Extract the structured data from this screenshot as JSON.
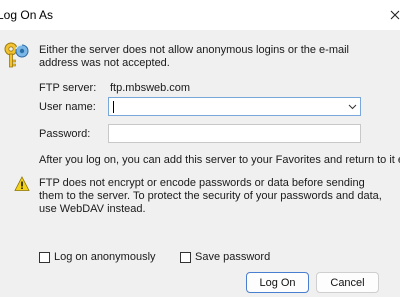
{
  "window": {
    "title": "Log On As"
  },
  "messages": {
    "anonymous_warning": "Either the server does not allow anonymous logins or the e-mail address was not accepted.",
    "favorites_note": "After you log on, you can add this server to your Favorites and return to it easily.",
    "security_warning": "FTP does not encrypt or encode passwords or data before sending them to the server.  To protect the security of your passwords and data, use WebDAV instead."
  },
  "ftp_server": {
    "label": "FTP server:",
    "value": "ftp.mbsweb.com"
  },
  "user_name": {
    "label": "User name:",
    "value": ""
  },
  "password": {
    "label": "Password:",
    "value": ""
  },
  "checkboxes": {
    "log_on_anonymously": {
      "label": "Log on anonymously",
      "checked": false
    },
    "save_password": {
      "label": "Save password",
      "checked": false
    }
  },
  "buttons": {
    "log_on": "Log On",
    "cancel": "Cancel"
  },
  "icons": {
    "header": "key-icon",
    "warning": "warning-icon",
    "close": "close-icon",
    "dropdown": "chevron-down-icon"
  },
  "colors": {
    "dialog_bg": "#f0f0f0",
    "accent_border": "#4a7fd0",
    "warning_yellow": "#f3d21b"
  }
}
